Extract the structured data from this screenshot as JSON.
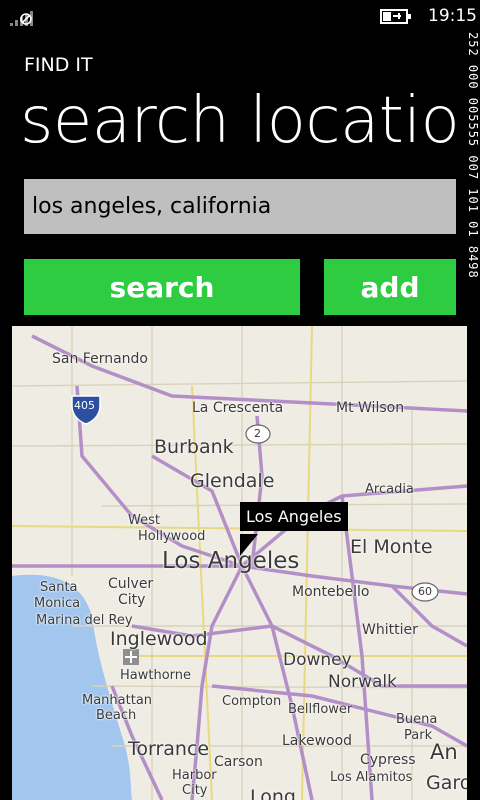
{
  "status": {
    "time": "19:15"
  },
  "debug_counter": "252 000 005555 007 101 01 8498",
  "header": {
    "app_title": "FIND IT",
    "page_title": "search location"
  },
  "search": {
    "value": "los angeles, california"
  },
  "buttons": {
    "search_label": "search",
    "add_label": "add"
  },
  "map": {
    "pin_label": "Los Angeles",
    "places": [
      {
        "name": "San Fernando"
      },
      {
        "name": "La Crescenta"
      },
      {
        "name": "Mt Wilson"
      },
      {
        "name": "Burbank"
      },
      {
        "name": "Glendale"
      },
      {
        "name": "Arcadia"
      },
      {
        "name": "West"
      },
      {
        "name": "Hollywood"
      },
      {
        "name": "Los Angeles"
      },
      {
        "name": "El Monte"
      },
      {
        "name": "Santa"
      },
      {
        "name": "Monica"
      },
      {
        "name": "Culver"
      },
      {
        "name": "City"
      },
      {
        "name": "Montebello"
      },
      {
        "name": "Marina del Rey"
      },
      {
        "name": "Inglewood"
      },
      {
        "name": "Whittier"
      },
      {
        "name": "Downey"
      },
      {
        "name": "Hawthorne"
      },
      {
        "name": "Norwalk"
      },
      {
        "name": "Manhattan"
      },
      {
        "name": "Beach"
      },
      {
        "name": "Compton"
      },
      {
        "name": "Bellflower"
      },
      {
        "name": "Buena"
      },
      {
        "name": "Park"
      },
      {
        "name": "Torrance"
      },
      {
        "name": "Lakewood"
      },
      {
        "name": "An"
      },
      {
        "name": "Carson"
      },
      {
        "name": "Cypress"
      },
      {
        "name": "Harbor"
      },
      {
        "name": "City"
      },
      {
        "name": "Los Alamitos"
      },
      {
        "name": "Garo"
      },
      {
        "name": "Long"
      }
    ],
    "shields": [
      {
        "num": "405"
      },
      {
        "num": "2"
      },
      {
        "num": "60"
      }
    ]
  }
}
